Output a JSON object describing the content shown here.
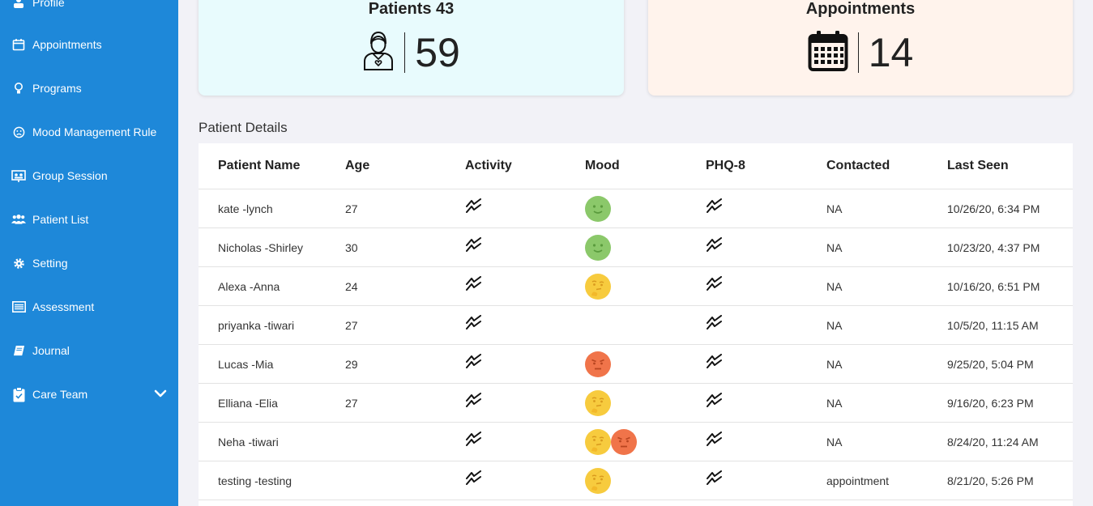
{
  "sidebar": {
    "items": [
      {
        "label": "Profile",
        "icon": "profile-icon"
      },
      {
        "label": "Appointments",
        "icon": "calendar-icon"
      },
      {
        "label": "Programs",
        "icon": "lightbulb-icon"
      },
      {
        "label": "Mood Management Rule",
        "icon": "sad-face-icon"
      },
      {
        "label": "Group Session",
        "icon": "group-session-icon"
      },
      {
        "label": "Patient List",
        "icon": "users-icon"
      },
      {
        "label": "Setting",
        "icon": "gear-icon"
      },
      {
        "label": "Assessment",
        "icon": "list-icon"
      },
      {
        "label": "Journal",
        "icon": "book-icon"
      },
      {
        "label": "Care Team",
        "icon": "clipboard-icon"
      }
    ]
  },
  "cards": {
    "patients": {
      "title": "Patients 43",
      "value": "59",
      "icon": "patient-icon"
    },
    "appointments": {
      "title": "Appointments",
      "value": "14",
      "icon": "calendar-icon"
    }
  },
  "patient_details": {
    "title": "Patient Details",
    "columns": [
      "Patient Name",
      "Age",
      "Activity",
      "Mood",
      "PHQ-8",
      "Contacted",
      "Last Seen"
    ],
    "rows": [
      {
        "name": "kate -lynch",
        "age": "27",
        "moods": [
          "happy"
        ],
        "contacted": "NA",
        "last_seen": "10/26/20, 6:34 PM"
      },
      {
        "name": "Nicholas -Shirley",
        "age": "30",
        "moods": [
          "happy"
        ],
        "contacted": "NA",
        "last_seen": "10/23/20, 4:37 PM"
      },
      {
        "name": "Alexa -Anna",
        "age": "24",
        "moods": [
          "thinking"
        ],
        "contacted": "NA",
        "last_seen": "10/16/20, 6:51 PM"
      },
      {
        "name": "priyanka -tiwari",
        "age": "27",
        "moods": [],
        "contacted": "NA",
        "last_seen": "10/5/20, 11:15 AM"
      },
      {
        "name": "Lucas -Mia",
        "age": "29",
        "moods": [
          "angry"
        ],
        "contacted": "NA",
        "last_seen": "9/25/20, 5:04 PM"
      },
      {
        "name": "Elliana -Elia",
        "age": "27",
        "moods": [
          "thinking"
        ],
        "contacted": "NA",
        "last_seen": "9/16/20, 6:23 PM"
      },
      {
        "name": "Neha -tiwari",
        "age": "",
        "moods": [
          "thinking",
          "angry"
        ],
        "contacted": "NA",
        "last_seen": "8/24/20, 11:24 AM"
      },
      {
        "name": "testing -testing",
        "age": "",
        "moods": [
          "thinking"
        ],
        "contacted": "appointment",
        "last_seen": "8/21/20, 5:26 PM"
      }
    ]
  },
  "colors": {
    "sidebar": "#1e88d9",
    "happy": "#8bc86a",
    "thinking": "#f7cb3e",
    "angry": "#f0744a"
  }
}
